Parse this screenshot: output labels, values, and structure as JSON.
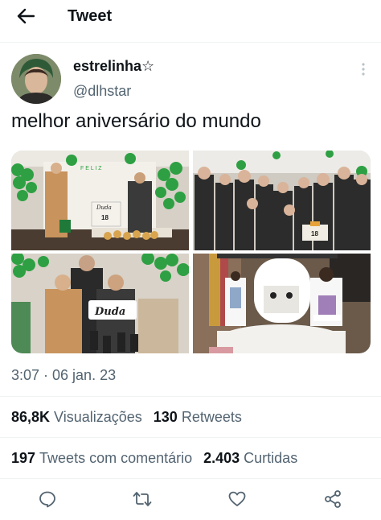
{
  "header": {
    "title": "Tweet",
    "back_icon": "arrow-left-icon"
  },
  "author": {
    "display_name": "estrelinha☆",
    "handle": "@dlhstar",
    "more_icon": "more-vertical-icon"
  },
  "tweet": {
    "text": "melhor aniversário do mundo",
    "timestamp": "3:07 · 06 jan. 23",
    "media": [
      {
        "photo_text": [
          "F E L I Z",
          "Duda",
          "18"
        ]
      },
      {
        "photo_text": [
          "18"
        ]
      },
      {
        "photo_text": [
          "Duda"
        ]
      },
      {
        "photo_text": []
      }
    ]
  },
  "stats": {
    "views_count": "86,8K",
    "views_label": "Visualizações",
    "retweets_count": "130",
    "retweets_label": "Retweets",
    "quotes_count": "197",
    "quotes_label": "Tweets com comentário",
    "likes_count": "2.403",
    "likes_label": "Curtidas"
  },
  "actions": [
    {
      "icon": "reply-icon"
    },
    {
      "icon": "retweet-icon"
    },
    {
      "icon": "like-icon"
    },
    {
      "icon": "share-icon"
    }
  ],
  "colors": {
    "text_primary": "#0f1419",
    "text_secondary": "#536471",
    "divider": "#eff3f4",
    "balloon_green": "#2ea043"
  }
}
